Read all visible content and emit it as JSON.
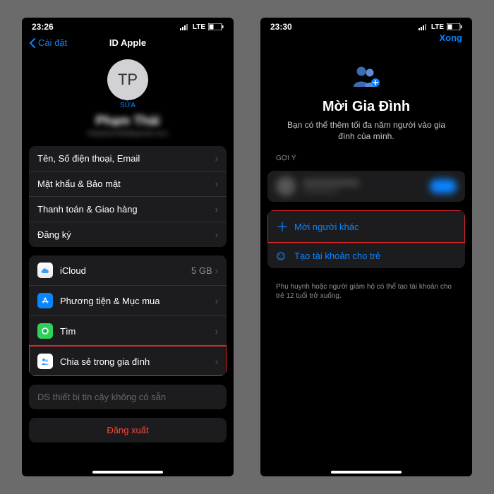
{
  "left": {
    "status": {
      "time": "23:26",
      "carrier": "LTE"
    },
    "nav": {
      "back": "Cài đặt",
      "title": "ID Apple"
    },
    "profile": {
      "initials": "TP",
      "edit": "SỬA",
      "name": "Phạm Thái",
      "email": "thaiphạm999@gmail.com"
    },
    "group1": [
      {
        "label": "Tên, Số điện thoại, Email"
      },
      {
        "label": "Mật khẩu & Bảo mật"
      },
      {
        "label": "Thanh toán & Giao hàng"
      },
      {
        "label": "Đăng ký"
      }
    ],
    "group2": [
      {
        "label": "iCloud",
        "detail": "5 GB"
      },
      {
        "label": "Phương tiện & Mục mua"
      },
      {
        "label": "Tìm"
      },
      {
        "label": "Chia sẻ trong gia đình"
      }
    ],
    "trusted": "DS thiết bị tin cậy không có sẵn",
    "signout": "Đăng xuất"
  },
  "right": {
    "status": {
      "time": "23:30",
      "carrier": "LTE"
    },
    "nav": {
      "done": "Xong"
    },
    "hero": {
      "title": "Mời Gia Đình",
      "sub": "Bạn có thể thêm tối đa năm người vào gia đình của mình."
    },
    "suggest_header": "GỢI Ý",
    "actions": {
      "invite": "Mời người khác",
      "child": "Tạo tài khoản cho trẻ"
    },
    "footer": "Phụ huynh hoặc người giám hộ có thể tạo tài khoản cho trẻ 12 tuổi trở xuống."
  }
}
